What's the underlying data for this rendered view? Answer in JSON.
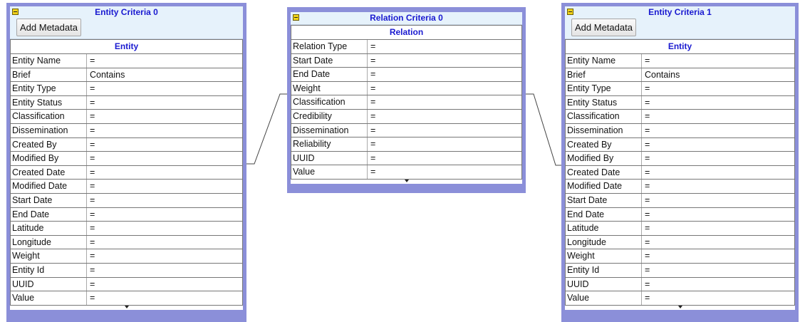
{
  "entity_panels": [
    {
      "title": "Entity Criteria 0",
      "add_button": "Add Metadata",
      "grid_header": "Entity",
      "rows": [
        {
          "name": "Entity Name",
          "value": "="
        },
        {
          "name": "Brief",
          "value": "Contains"
        },
        {
          "name": "Entity Type",
          "value": "="
        },
        {
          "name": "Entity Status",
          "value": "="
        },
        {
          "name": "Classification",
          "value": "="
        },
        {
          "name": "Dissemination",
          "value": "="
        },
        {
          "name": "Created By",
          "value": "="
        },
        {
          "name": "Modified By",
          "value": "="
        },
        {
          "name": "Created Date",
          "value": "="
        },
        {
          "name": "Modified Date",
          "value": "="
        },
        {
          "name": "Start Date",
          "value": "="
        },
        {
          "name": "End Date",
          "value": "="
        },
        {
          "name": "Latitude",
          "value": "="
        },
        {
          "name": "Longitude",
          "value": "="
        },
        {
          "name": "Weight",
          "value": "="
        },
        {
          "name": "Entity Id",
          "value": "="
        },
        {
          "name": "UUID",
          "value": "="
        },
        {
          "name": "Value",
          "value": "="
        }
      ]
    },
    {
      "title": "Entity Criteria 1",
      "add_button": "Add Metadata",
      "grid_header": "Entity",
      "rows": [
        {
          "name": "Entity Name",
          "value": "="
        },
        {
          "name": "Brief",
          "value": "Contains"
        },
        {
          "name": "Entity Type",
          "value": "="
        },
        {
          "name": "Entity Status",
          "value": "="
        },
        {
          "name": "Classification",
          "value": "="
        },
        {
          "name": "Dissemination",
          "value": "="
        },
        {
          "name": "Created By",
          "value": "="
        },
        {
          "name": "Modified By",
          "value": "="
        },
        {
          "name": "Created Date",
          "value": "="
        },
        {
          "name": "Modified Date",
          "value": "="
        },
        {
          "name": "Start Date",
          "value": "="
        },
        {
          "name": "End Date",
          "value": "="
        },
        {
          "name": "Latitude",
          "value": "="
        },
        {
          "name": "Longitude",
          "value": "="
        },
        {
          "name": "Weight",
          "value": "="
        },
        {
          "name": "Entity Id",
          "value": "="
        },
        {
          "name": "UUID",
          "value": "="
        },
        {
          "name": "Value",
          "value": "="
        }
      ]
    }
  ],
  "relation_panel": {
    "title": "Relation Criteria 0",
    "grid_header": "Relation",
    "rows": [
      {
        "name": "Relation Type",
        "value": "="
      },
      {
        "name": "Start Date",
        "value": "="
      },
      {
        "name": "End Date",
        "value": "="
      },
      {
        "name": "Weight",
        "value": "="
      },
      {
        "name": "Classification",
        "value": "="
      },
      {
        "name": "Credibility",
        "value": "="
      },
      {
        "name": "Dissemination",
        "value": "="
      },
      {
        "name": "Reliability",
        "value": "="
      },
      {
        "name": "UUID",
        "value": "="
      },
      {
        "name": "Value",
        "value": "="
      }
    ]
  },
  "colors": {
    "panel_border": "#8b8fd9",
    "header_bg": "#e6f2fb",
    "title_text": "#1a1ad0",
    "collapse_button": "#f2d31a"
  },
  "icons": {
    "collapse": "collapse-minus-icon",
    "expand_more": "triangle-down-icon"
  }
}
